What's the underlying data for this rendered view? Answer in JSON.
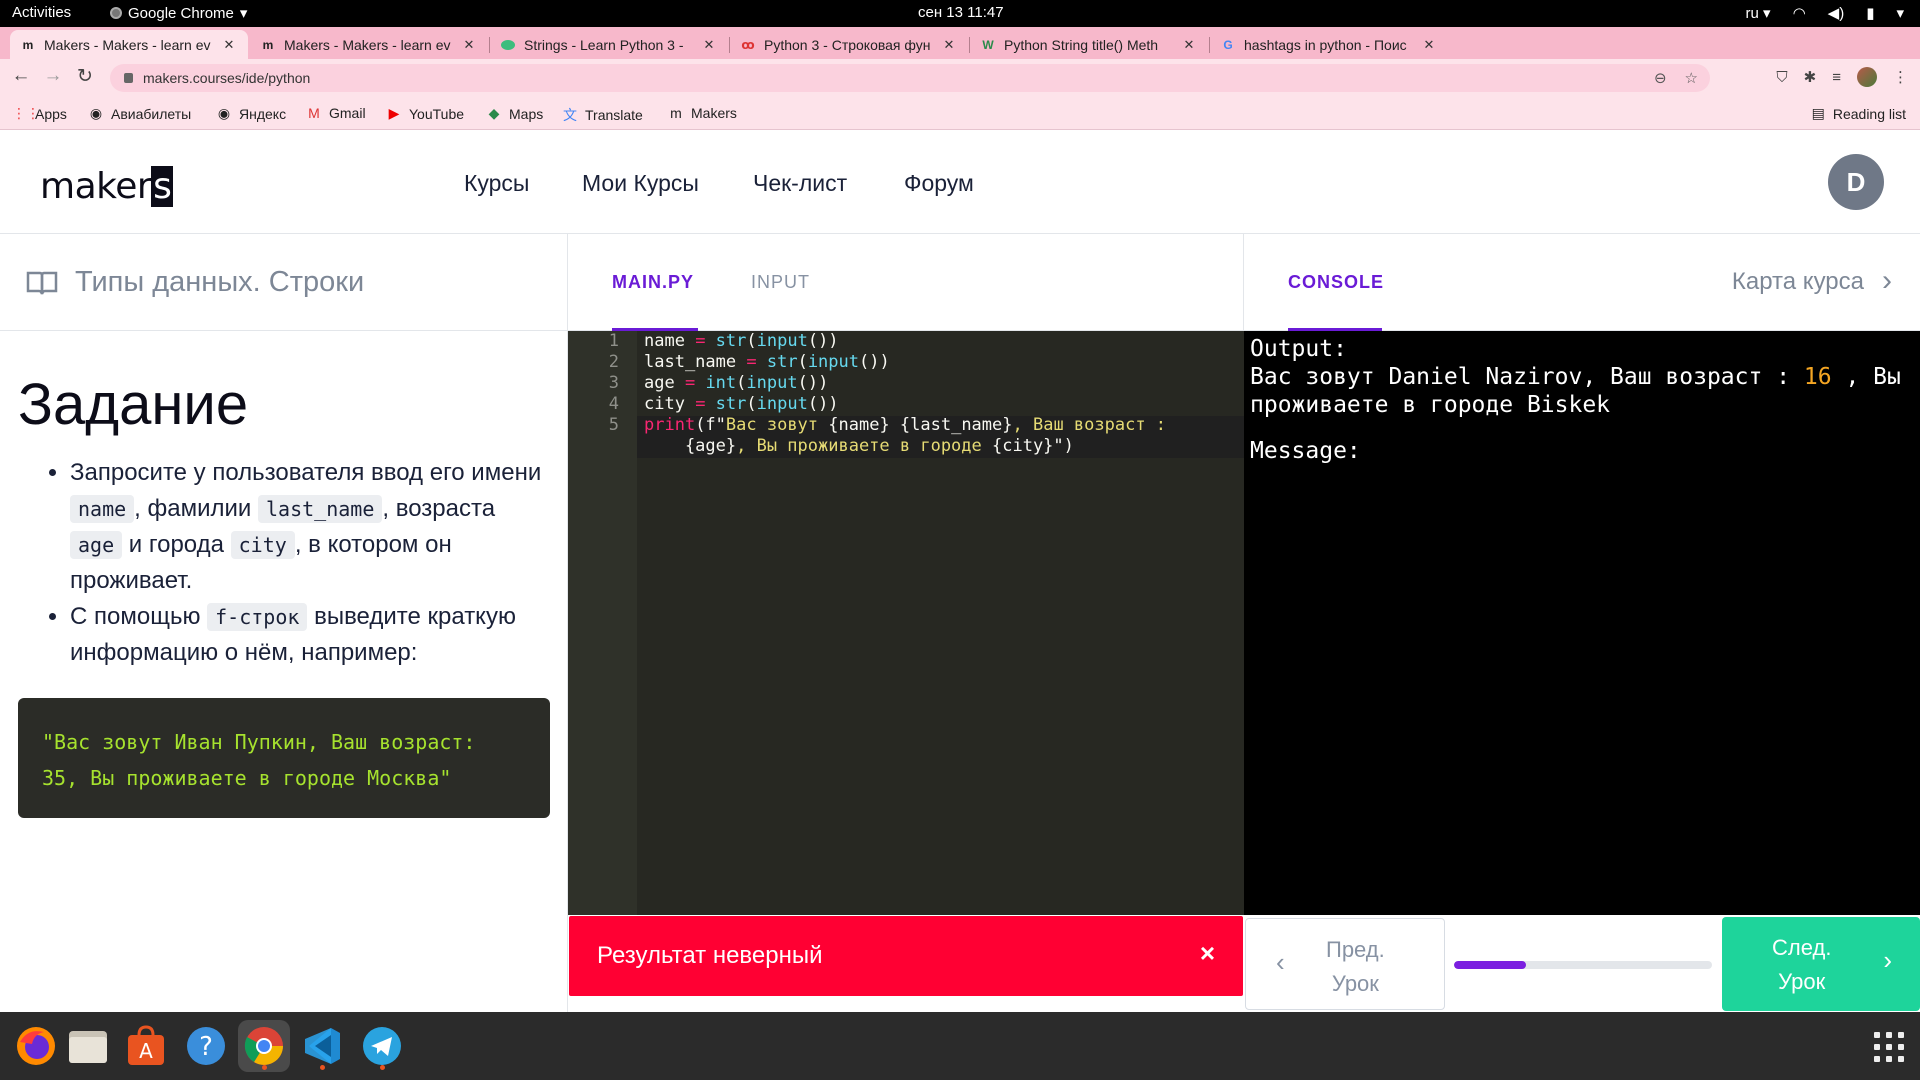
{
  "system": {
    "activities": "Activities",
    "app_name": "Google Chrome",
    "clock": "сен 13  11:47",
    "language": "ru"
  },
  "browser": {
    "tabs": [
      {
        "label": "Makers - Makers - learn ev",
        "favicon": "m",
        "active": true
      },
      {
        "label": "Makers - Makers - learn ev",
        "favicon": "m",
        "active": false
      },
      {
        "label": "Strings - Learn Python 3 - ",
        "favicon": "strings-favicon",
        "active": false
      },
      {
        "label": "Python 3 - Строковая фун",
        "favicon": "python-favicon",
        "active": false
      },
      {
        "label": "Python String title() Meth",
        "favicon": "W",
        "active": false
      },
      {
        "label": "hashtags in python - Поис",
        "favicon": "G",
        "active": false
      }
    ],
    "url": "makers.courses/ide/python",
    "bookmarks": [
      {
        "label": "Apps",
        "icon": "apps-grid-icon"
      },
      {
        "label": "Авиабилеты",
        "icon": "airplane-icon"
      },
      {
        "label": "Яндекс",
        "icon": "yandex-icon"
      },
      {
        "label": "Gmail",
        "icon": "gmail-icon"
      },
      {
        "label": "YouTube",
        "icon": "youtube-icon"
      },
      {
        "label": "Maps",
        "icon": "maps-icon"
      },
      {
        "label": "Translate",
        "icon": "translate-icon"
      },
      {
        "label": "Makers",
        "icon": "makers-icon"
      }
    ],
    "reading_list": "Reading list"
  },
  "site": {
    "logo": "maker",
    "logo_s": "s",
    "nav": [
      "Курсы",
      "Мои Курсы",
      "Чек-лист",
      "Форум"
    ],
    "avatar_initial": "D"
  },
  "lesson": {
    "title": "Типы данных. Строки",
    "heading": "Задание",
    "bullet1_a": "Запросите у пользователя ввод его имени ",
    "code_name": "name",
    "bullet1_b": ", фамилии ",
    "code_last_name": "last_name",
    "bullet1_c": ", возраста ",
    "code_age": "age",
    "bullet1_d": " и города ",
    "code_city": "city",
    "bullet1_e": ", в котором он проживает.",
    "bullet2_a": "С помощью ",
    "code_fstr": "f-строк",
    "bullet2_b": " выведите краткую информацию о нём, например:",
    "example_line1": "\"Вас зовут Иван Пупкин, Ваш возраст:",
    "example_line2": "35, Вы проживаете в городе Москва\""
  },
  "editor": {
    "tab_main": "MAIN.PY",
    "tab_input": "INPUT",
    "line_numbers": [
      "1",
      "2",
      "3",
      "4",
      "5"
    ],
    "lines": [
      {
        "var": "name",
        "op": " = ",
        "f1": "str",
        "p1": "(",
        "f2": "input",
        "p2": "())"
      },
      {
        "var": "last_name",
        "op": " = ",
        "f1": "str",
        "p1": "(",
        "f2": "input",
        "p2": "())"
      },
      {
        "var": "age",
        "op": " = ",
        "f1": "int",
        "p1": "(",
        "f2": "input",
        "p2": "())"
      },
      {
        "var": "city",
        "op": " = ",
        "f1": "str",
        "p1": "(",
        "f2": "input",
        "p2": "())"
      }
    ],
    "line5_print": "print",
    "line5_open": "(f\"",
    "line5_s1": "Вас зовут ",
    "line5_v1": "{name} {last_name}",
    "line5_s2": ", Ваш возраст :",
    "line5_v2": "    {age}",
    "line5_s3": ", Вы проживаете в городе ",
    "line5_v3": "{city}",
    "line5_close": "\")"
  },
  "error": {
    "message": "Результат неверный",
    "close": "×"
  },
  "console": {
    "tab": "CONSOLE",
    "course_map": "Карта курса",
    "output_label": "Output:",
    "out_a": "Вас зовут Daniel Nazirov, Ваш возраст : ",
    "out_num": "16",
    "out_b": " , Вы",
    "out_line2": "проживаете в городе Biskek",
    "message_label": "Message:"
  },
  "lesson_nav": {
    "prev_line1": "Пред.",
    "prev_line2": "Урок",
    "next_line1": "След.",
    "next_line2": "Урок",
    "progress": 0.28
  },
  "dock": [
    "firefox-icon",
    "files-icon",
    "software-center-icon",
    "help-icon",
    "chrome-icon",
    "vscode-icon",
    "telegram-icon"
  ],
  "colors": {
    "accent": "#6a1bd6",
    "error": "#ff0033",
    "next": "#1ed49b"
  }
}
